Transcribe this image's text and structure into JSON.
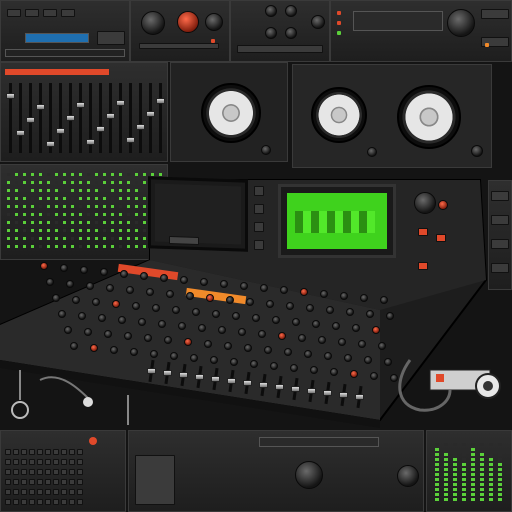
{
  "scene": {
    "accent_red": "#e0492a",
    "accent_orange": "#f08a2a",
    "screen_green": "#3fd21d",
    "lcd_blue": "#1f6fb0",
    "meter_green": "#5bd03a"
  },
  "icons": {
    "speaker": "speaker-icon",
    "knob": "knob-icon",
    "headphone_jack": "cable-icon"
  },
  "readouts": {
    "console_brand": "",
    "display_text": ""
  }
}
